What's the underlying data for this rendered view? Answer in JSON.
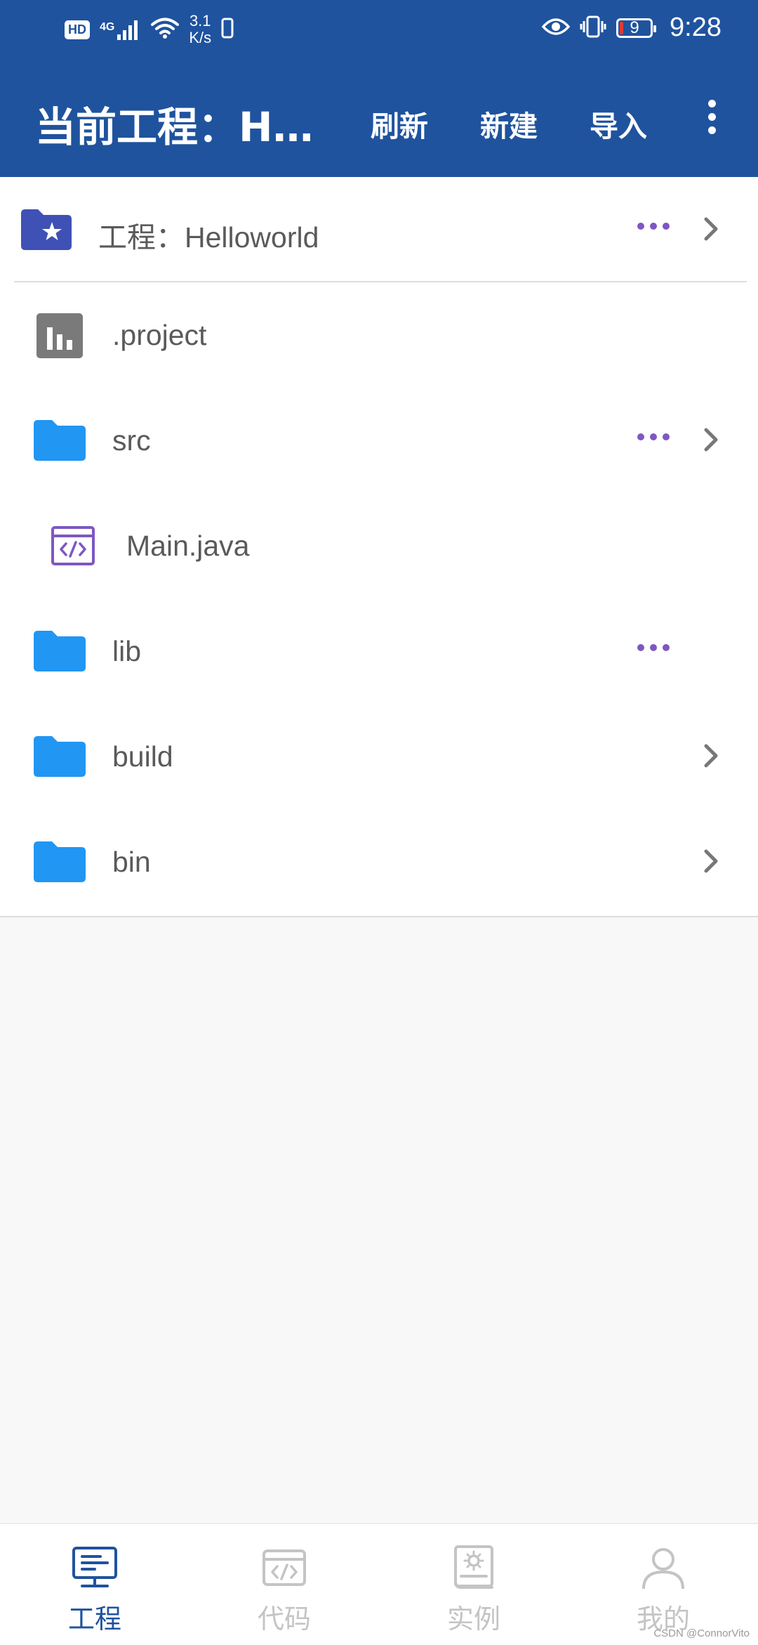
{
  "status_bar": {
    "hd_badge": "HD",
    "network": "4G",
    "speed_value": "3.1",
    "speed_unit": "K/s",
    "battery_level": "9",
    "time": "9:28"
  },
  "app_bar": {
    "title": "当前工程：H…",
    "actions": {
      "refresh": "刷新",
      "new": "新建",
      "import": "导入"
    }
  },
  "project_header": {
    "label": "工程：Helloworld"
  },
  "files": [
    {
      "name": ".project",
      "type": "project-file-icon",
      "has_more": false,
      "has_chevron": false
    },
    {
      "name": "src",
      "type": "folder-icon",
      "has_more": true,
      "has_chevron": true
    },
    {
      "name": "Main.java",
      "type": "code-file-icon",
      "has_more": false,
      "has_chevron": false
    },
    {
      "name": "lib",
      "type": "folder-icon",
      "has_more": true,
      "has_chevron": false
    },
    {
      "name": "build",
      "type": "folder-icon",
      "has_more": false,
      "has_chevron": true
    },
    {
      "name": "bin",
      "type": "folder-icon",
      "has_more": false,
      "has_chevron": true
    }
  ],
  "bottom_nav": [
    {
      "label": "工程",
      "icon": "monitor-icon",
      "active": true
    },
    {
      "label": "代码",
      "icon": "code-window-icon",
      "active": false
    },
    {
      "label": "实例",
      "icon": "example-book-icon",
      "active": false
    },
    {
      "label": "我的",
      "icon": "person-icon",
      "active": false
    }
  ],
  "watermark": "CSDN @ConnorVito",
  "colors": {
    "primary": "#1f539e",
    "folder": "#2196f3",
    "accent_dots": "#7e57c2",
    "header_folder": "#3f51b5"
  }
}
